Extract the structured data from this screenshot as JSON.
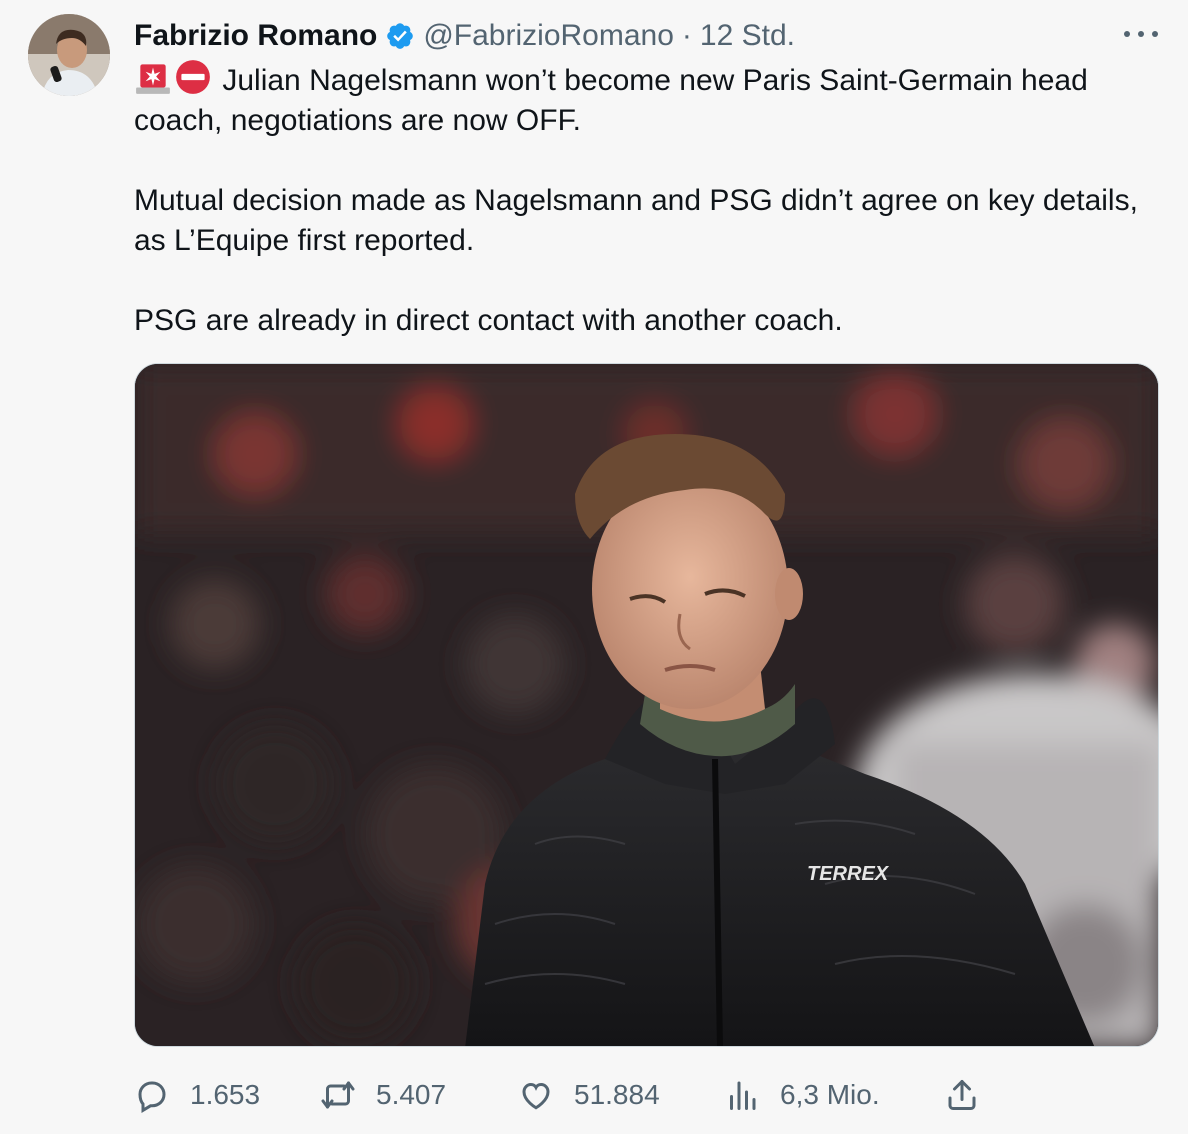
{
  "tweet": {
    "author_name": "Fabrizio Romano",
    "handle": "@FabrizioRomano",
    "separator": "·",
    "time": "12 Std.",
    "paragraphs": [
      "Julian Nagelsmann won’t become new Paris Saint-Germain head coach, negotiations are now OFF.",
      "Mutual decision made as Nagelsmann and PSG didn’t agree on key details, as L’Equipe first reported.",
      "PSG are already in direct contact with another coach."
    ],
    "leading_emojis": [
      "rotating-light-icon",
      "no-entry-icon"
    ],
    "media": {
      "jacket_brand_text": "TERREX"
    },
    "actions": {
      "replies": "1.653",
      "retweets": "5.407",
      "likes": "51.884",
      "views": "6,3 Mio."
    }
  },
  "colors": {
    "text_primary": "#0f1419",
    "text_secondary": "#536471",
    "verified_blue": "#1d9bf0",
    "background": "#f7f7f7"
  }
}
